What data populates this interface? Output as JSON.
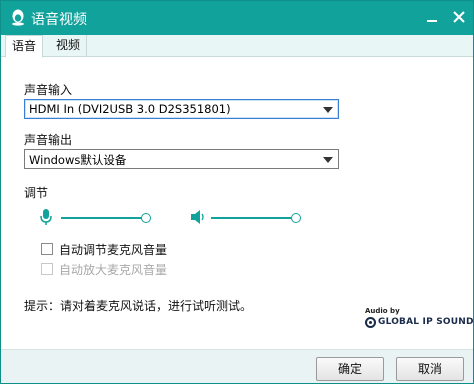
{
  "window": {
    "title": "语音视频"
  },
  "tabs": [
    {
      "label": "语音"
    },
    {
      "label": "视频"
    }
  ],
  "sound_input": {
    "label": "声音输入",
    "selected": "HDMI In (DVI2USB 3.0 D2S351801)"
  },
  "sound_output": {
    "label": "声音输出",
    "selected": "Windows默认设备"
  },
  "adjust": {
    "label": "调节",
    "mic_level": 1.0,
    "speaker_level": 1.0
  },
  "options": [
    {
      "label": "自动调节麦克风音量",
      "checked": false,
      "disabled": false
    },
    {
      "label": "自动放大麦克风音量",
      "checked": false,
      "disabled": true
    }
  ],
  "hint": "提示：请对着麦克风说话，进行试听测试。",
  "branding": {
    "audio_by": "Audio by",
    "brand": "GLOBAL IP SOUND"
  },
  "footer": {
    "ok_label": "确定",
    "cancel_label": "取消"
  },
  "colors": {
    "accent": "#11a29b",
    "tab_bar": "#e8f6f5",
    "footer": "#eaf3f3"
  }
}
